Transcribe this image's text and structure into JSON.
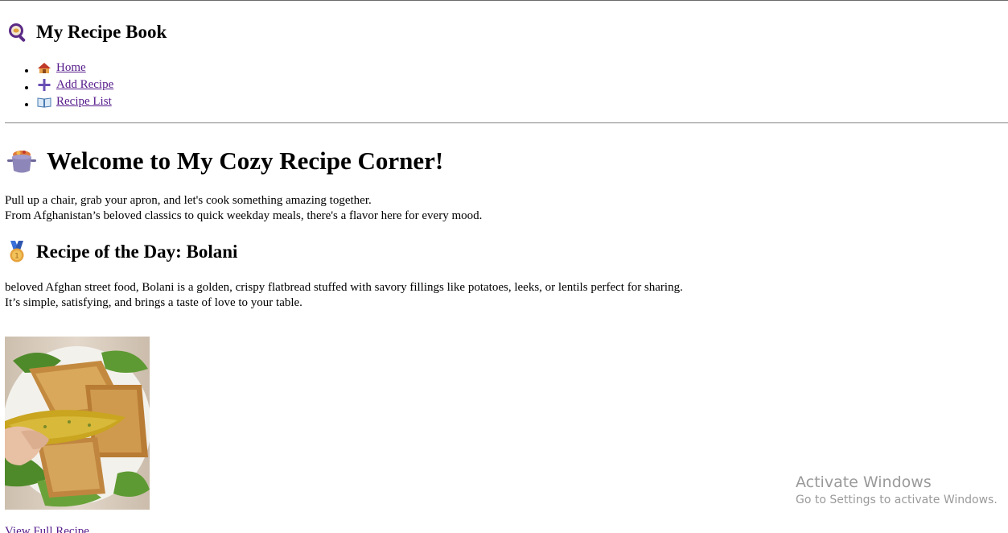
{
  "header": {
    "logo_icon": "magnifier-recipe-icon",
    "title": "My Recipe Book"
  },
  "nav": {
    "items": [
      {
        "label": " Home",
        "icon": "house-icon"
      },
      {
        "label": " Add Recipe",
        "icon": "plus-icon"
      },
      {
        "label": " Recipe List",
        "icon": "open-book-icon"
      }
    ]
  },
  "hero": {
    "icon": "cooking-pot-icon",
    "title": "Welcome to My Cozy Recipe Corner!",
    "intro_line1": "Pull up a chair, grab your apron, and let's cook something amazing together.",
    "intro_line2": "From Afghanistan’s beloved classics to quick weekday meals, there's a flavor here for every mood."
  },
  "recipe_of_day": {
    "icon": "medal-icon",
    "title": "Recipe of the Day: Bolani",
    "desc_line1": "beloved Afghan street food, Bolani is a golden, crispy flatbread stuffed with savory fillings like potatoes, leeks, or lentils perfect for sharing.",
    "desc_line2": "It’s simple, satisfying, and brings a taste of love to your table.",
    "image_alt": "Bolani flatbread",
    "link_label": "View Full Recipe"
  },
  "windows_watermark": {
    "title": "Activate Windows",
    "subtitle": "Go to Settings to activate Windows."
  },
  "colors": {
    "link": "#551a8b",
    "watermark": "#9a9a9a",
    "nav_icon_purple": "#6a4fb3"
  }
}
